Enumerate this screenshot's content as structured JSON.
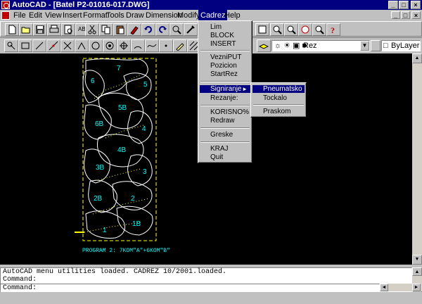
{
  "window": {
    "title": "AutoCAD - [Batel P2-01016-017.DWG]",
    "min": "_",
    "max": "□",
    "close": "×"
  },
  "menubar": {
    "items": [
      {
        "label": "File"
      },
      {
        "label": "Edit"
      },
      {
        "label": "View"
      },
      {
        "label": "Insert"
      },
      {
        "label": "Format"
      },
      {
        "label": "Tools"
      },
      {
        "label": "Draw"
      },
      {
        "label": "Dimension"
      },
      {
        "label": "Modify"
      },
      {
        "label": "Cadrez"
      },
      {
        "label": "Help"
      }
    ],
    "active": "Cadrez"
  },
  "toolbar": {
    "layer_name": "Rez",
    "linetype": "ByLayer"
  },
  "icons": [
    "new-icon",
    "open-icon",
    "save-icon",
    "print-icon",
    "preview-icon",
    "spell-icon",
    "cut-icon",
    "copy-icon",
    "paste-icon",
    "match-icon",
    "undo-icon",
    "redo-icon",
    "snap-icon",
    "help-icon"
  ],
  "cadrez_menu": {
    "items": [
      {
        "label": "Lim"
      },
      {
        "label": "BLOCK"
      },
      {
        "label": "INSERT"
      },
      {
        "label": "VezniPUT"
      },
      {
        "label": "Pozicion"
      },
      {
        "label": "StartRez"
      },
      {
        "label": "Signiranje"
      },
      {
        "label": "Rezanje:"
      },
      {
        "label": "KORISNO%"
      },
      {
        "label": "Redraw"
      },
      {
        "label": "Greske"
      },
      {
        "label": "KRAJ"
      },
      {
        "label": "Quit"
      }
    ],
    "highlighted": "Signiranje"
  },
  "submenu": {
    "items": [
      {
        "label": "Pneumatsko"
      },
      {
        "label": "Tockalo"
      },
      {
        "label": "Praskom"
      }
    ],
    "highlighted": "Pneumatsko"
  },
  "drawing": {
    "program_label": "PROGRAM 2: 7KOM\"A\"+6KOM\"B\"",
    "part_labels": [
      "7",
      "6",
      "5",
      "5B",
      "6B",
      "4",
      "4B",
      "3B",
      "3",
      "2B",
      "2",
      "1",
      "1B"
    ]
  },
  "command": {
    "history": [
      "AutoCAD menu utilities loaded. CADREZ 10/2001.loaded.",
      "Command:"
    ],
    "prompt": "Command:"
  },
  "colors": {
    "titlebar": "#000080",
    "drawing_bg": "#000000",
    "outline": "#ffffff",
    "labels": "#00ffff",
    "frame": "#ffff00"
  }
}
